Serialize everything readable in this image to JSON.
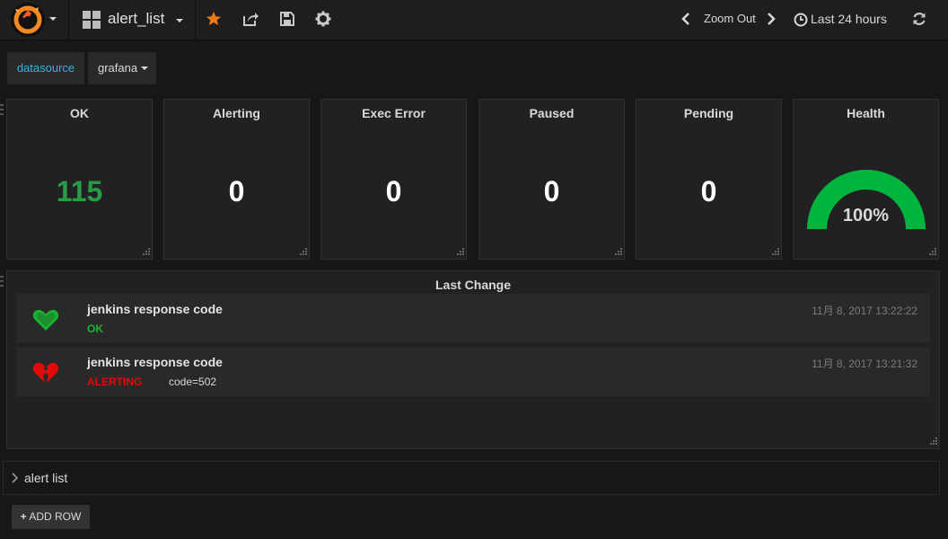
{
  "navbar": {
    "dashboard_title": "alert_list",
    "zoom_out_label": "Zoom Out",
    "time_range_label": "Last 24 hours",
    "icons": [
      "grafana-logo-icon",
      "dashboard-grid-icon",
      "star-icon",
      "share-icon",
      "save-icon",
      "gear-icon",
      "chevron-left-icon",
      "chevron-right-icon",
      "clock-icon",
      "refresh-icon"
    ],
    "star_color": "#eb7b18"
  },
  "template_variable": {
    "label": "datasource",
    "value": "grafana"
  },
  "stat_panels": [
    {
      "title": "OK",
      "value": "115",
      "color": "#299c46"
    },
    {
      "title": "Alerting",
      "value": "0",
      "color": "#ffffff"
    },
    {
      "title": "Exec Error",
      "value": "0",
      "color": "#ffffff"
    },
    {
      "title": "Paused",
      "value": "0",
      "color": "#ffffff"
    },
    {
      "title": "Pending",
      "value": "0",
      "color": "#ffffff"
    }
  ],
  "health_panel": {
    "title": "Health",
    "value": "100%",
    "fraction": 1.0,
    "gauge_color": "#00b43c"
  },
  "last_change": {
    "title": "Last Change",
    "items": [
      {
        "name": "jenkins response code",
        "state": "OK",
        "state_color": "#1ab32f",
        "info": "",
        "time": "11月 8, 2017 13:22:22",
        "icon": "heart-icon"
      },
      {
        "name": "jenkins response code",
        "state": "ALERTING",
        "state_color": "#e20a0a",
        "info": "code=502",
        "time": "11月 8, 2017 13:21:32",
        "icon": "broken-heart-icon"
      }
    ]
  },
  "collapsed_row": {
    "title": "alert list"
  },
  "add_row_label": "ADD ROW"
}
